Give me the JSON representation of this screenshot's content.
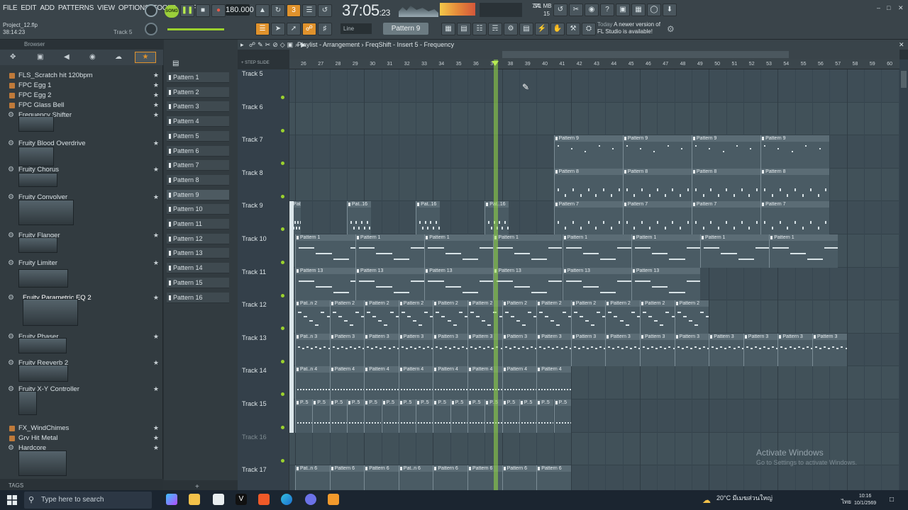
{
  "menu": [
    "FILE",
    "EDIT",
    "ADD",
    "PATTERNS",
    "VIEW",
    "OPTIONS",
    "TOOLS",
    "HELP"
  ],
  "project": {
    "file": "Project_12.flp",
    "elapsed": "38:14:23",
    "hint": "Track 5"
  },
  "transport": {
    "mode": "SONG",
    "tempo": "180.000",
    "time_main": "37:05",
    "time_sub": ":23"
  },
  "cpu": {
    "memory": "771 MB",
    "voices": "15",
    "cpu_val": "34"
  },
  "toolbar": {
    "snap": "Line",
    "pattern": "Pattern 9"
  },
  "news": {
    "label": "Today",
    "text": "A newer version of FL Studio is available!"
  },
  "browser": {
    "title": "Browser",
    "items": [
      {
        "label": "FLS_Scratch hit 120bpm",
        "kind": "file"
      },
      {
        "label": "FPC Egg 1",
        "kind": "file"
      },
      {
        "label": "FPC Egg 2",
        "kind": "file"
      },
      {
        "label": "FPC Glass Bell",
        "kind": "file"
      },
      {
        "label": "Frequency Shifter",
        "kind": "plugin"
      },
      {
        "label": "Fruity Blood Overdrive",
        "kind": "plugin"
      },
      {
        "label": "Fruity Chorus",
        "kind": "plugin"
      },
      {
        "label": "Fruity Convolver",
        "kind": "plugin"
      },
      {
        "label": "Fruity Flanger",
        "kind": "plugin"
      },
      {
        "label": "Fruity Limiter",
        "kind": "plugin"
      },
      {
        "label": "Fruity Parametric EQ 2",
        "kind": "plugin"
      },
      {
        "label": "Fruity Phaser",
        "kind": "plugin"
      },
      {
        "label": "Fruity Reeverb 2",
        "kind": "plugin"
      },
      {
        "label": "Fruity X-Y Controller",
        "kind": "plugin"
      },
      {
        "label": "FX_WindChimes",
        "kind": "file"
      },
      {
        "label": "Grv Hit Metal",
        "kind": "file"
      },
      {
        "label": "Hardcore",
        "kind": "plugin"
      }
    ],
    "tags_label": "TAGS"
  },
  "patterns": [
    "Pattern 1",
    "Pattern 2",
    "Pattern 3",
    "Pattern 4",
    "Pattern 5",
    "Pattern 6",
    "Pattern 7",
    "Pattern 8",
    "Pattern 9",
    "Pattern 10",
    "Pattern 11",
    "Pattern 12",
    "Pattern 13",
    "Pattern 14",
    "Pattern 15",
    "Pattern 16"
  ],
  "playlist": {
    "breadcrumb": "Playlist - Arrangement › FreqShift - Insert 5 - Frequency",
    "ruler": [
      "26",
      "27",
      "28",
      "29",
      "30",
      "31",
      "32",
      "33",
      "34",
      "35",
      "36",
      "37",
      "38",
      "39",
      "40",
      "41",
      "42",
      "43",
      "44",
      "45",
      "46",
      "47",
      "48",
      "49",
      "50",
      "51",
      "52",
      "53",
      "54",
      "55",
      "56",
      "57",
      "58",
      "59",
      "60"
    ],
    "tracks": [
      "Track 5",
      "Track 6",
      "Track 7",
      "Track 8",
      "Track 9",
      "Track 10",
      "Track 11",
      "Track 12",
      "Track 13",
      "Track 14",
      "Track 15",
      "Track 16",
      "Track 17"
    ]
  },
  "clip_labels": {
    "p1": "Pattern 1",
    "p2": "Pattern 2",
    "p2s": "Pat..n 2",
    "p3": "Pattern 3",
    "p3s": "Pat..n 3",
    "p4": "Pattern 4",
    "p4s": "Pat..n 4",
    "p5": "P..5",
    "p6": "Pattern 6",
    "p6s": "Pat..n 6",
    "p7": "Pattern 7",
    "p8": "Pattern 8",
    "p9": "Pattern 9",
    "p13": "Pattern 13",
    "p16": "Pat..16"
  },
  "watermark": {
    "title": "Activate Windows",
    "sub": "Go to Settings to activate Windows."
  },
  "taskbar": {
    "search": "Type here to search",
    "weather": "20°C",
    "weather_text": "มีเมฆส่วนใหญ่",
    "lang": "ไทย",
    "time": "10:16",
    "date": "10/1/2569"
  }
}
